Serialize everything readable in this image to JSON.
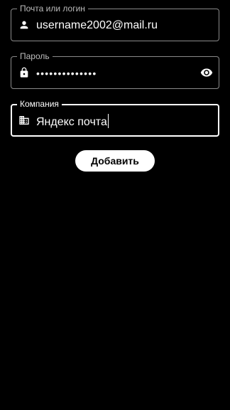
{
  "form": {
    "login": {
      "label": "Почта или логин",
      "value": "username2002@mail.ru",
      "icon": "person-icon"
    },
    "password": {
      "label": "Пароль",
      "value": "••••••••••••••",
      "icon": "lock-icon",
      "toggle_icon": "eye-icon"
    },
    "company": {
      "label": "Компания",
      "value": "Яндекс почта",
      "icon": "business-icon"
    },
    "add_button_label": "Добавить"
  },
  "colors": {
    "background": "#000000",
    "text": "#ffffff",
    "border": "#8a8a8a",
    "button_bg": "#ffffff",
    "button_text": "#000000"
  }
}
